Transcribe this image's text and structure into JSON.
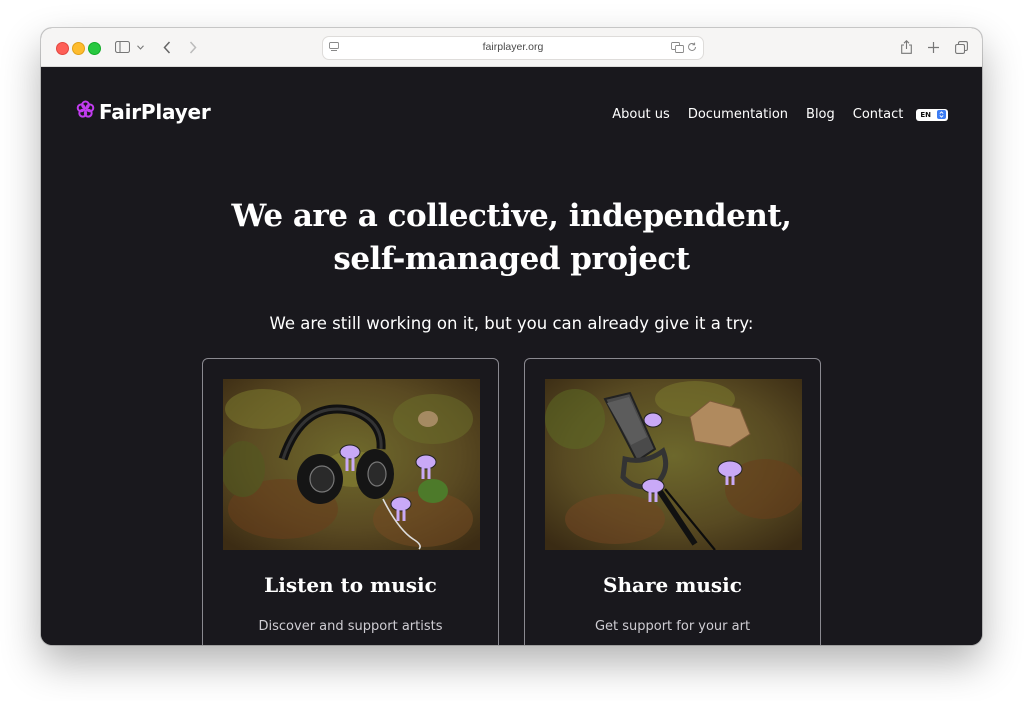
{
  "browser": {
    "url": "fairplayer.org"
  },
  "site": {
    "logo_text": "FairPlayer",
    "nav": [
      "About us",
      "Documentation",
      "Blog",
      "Contact"
    ],
    "language": "EN"
  },
  "hero": {
    "headline": "We are a collective, independent, self-managed project",
    "subline": "We are still working on it, but you can already give it a try:"
  },
  "cards": [
    {
      "title": "Listen to music",
      "description": "Discover and support artists"
    },
    {
      "title": "Share music",
      "description": "Get support for your art"
    }
  ],
  "colors": {
    "page_bg": "#19181d",
    "logo_accent": "#c23cf0",
    "mascot": "#c9a9f7"
  }
}
